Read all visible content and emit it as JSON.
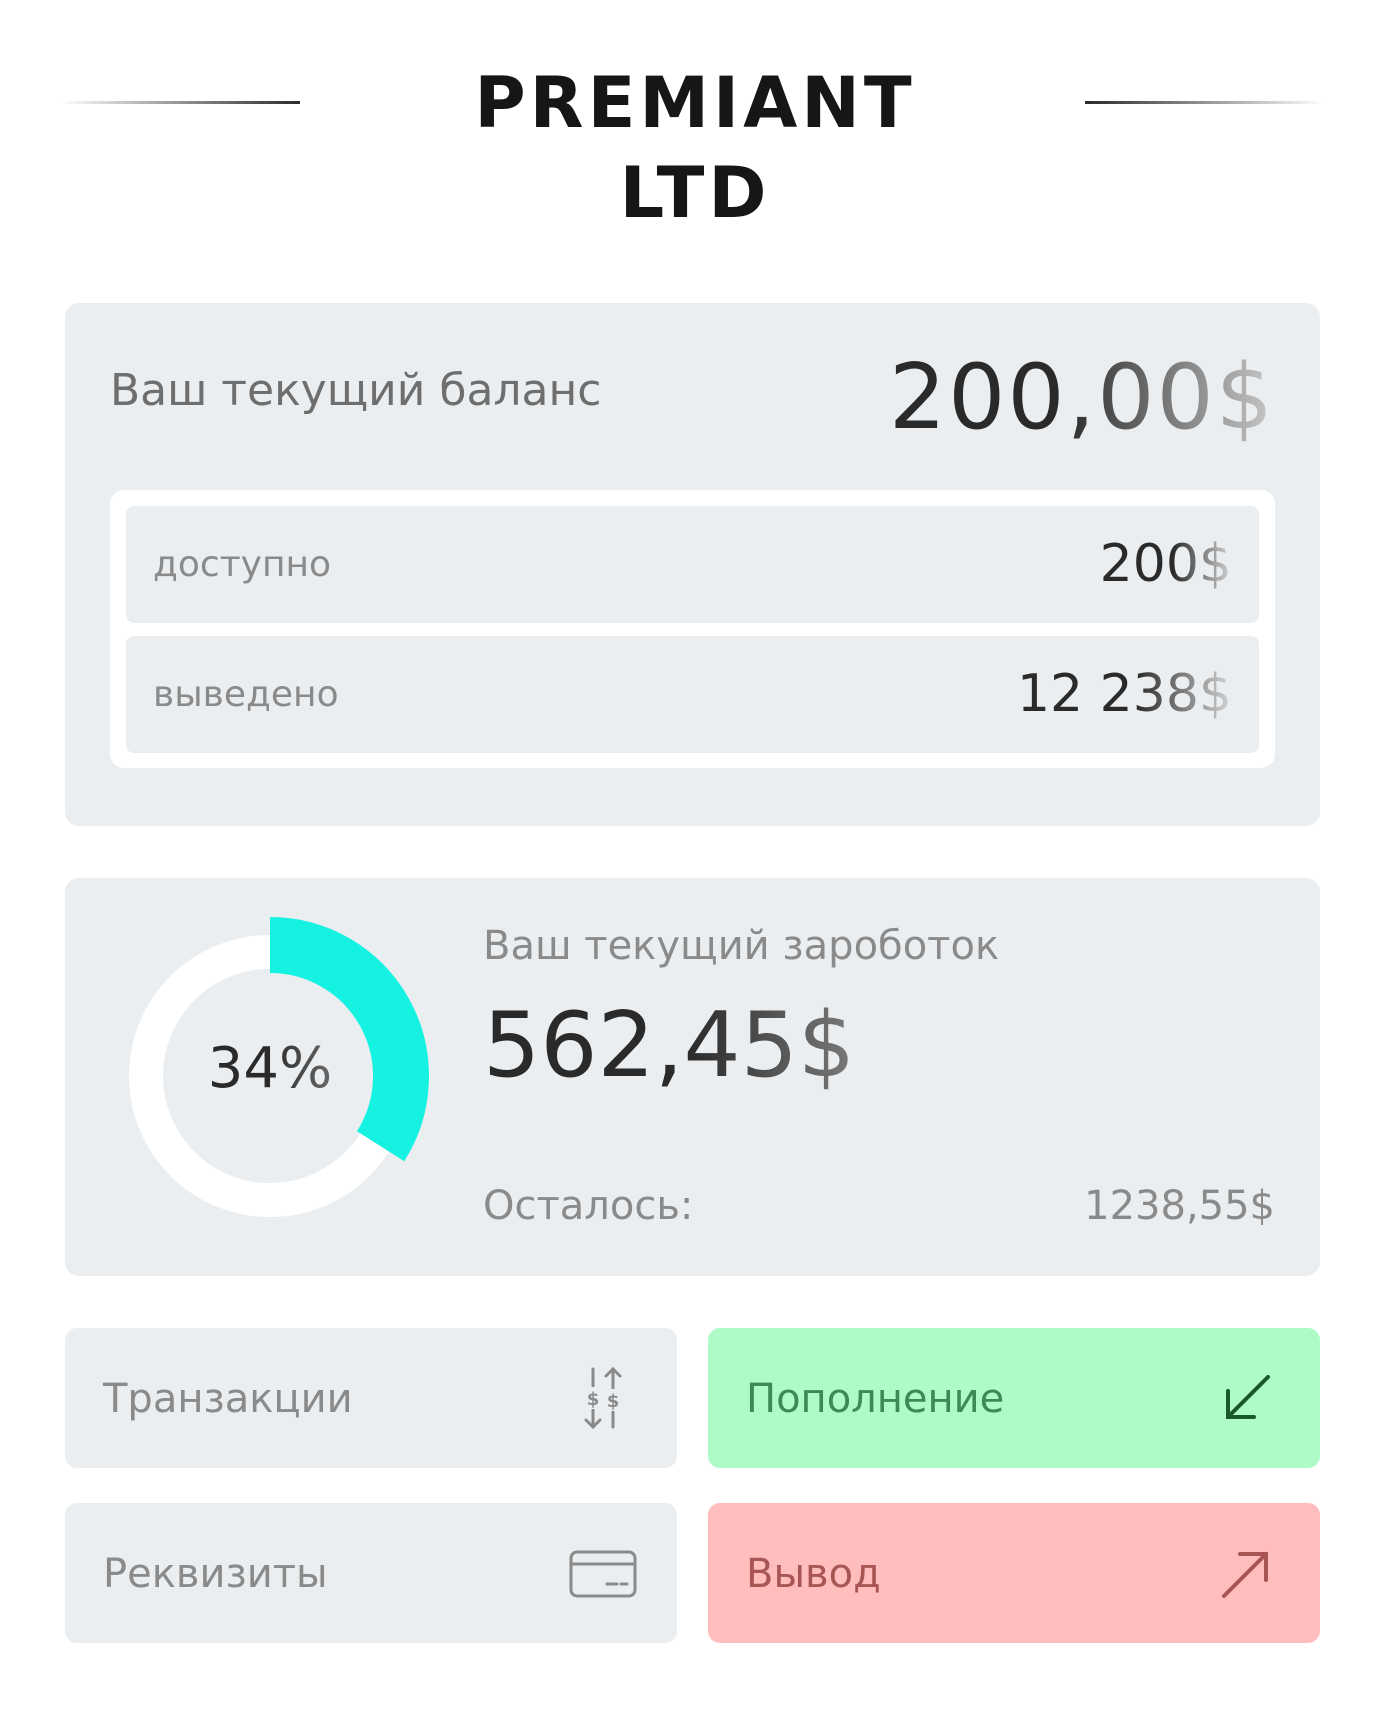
{
  "header": {
    "logo_text": "PREMIANT LTD"
  },
  "balance": {
    "title": "Ваш текущий баланс",
    "amount": "200,00$",
    "available_label": "доступно",
    "available_value": "200$",
    "withdrawn_label": "выведено",
    "withdrawn_value": "12 238$"
  },
  "earnings": {
    "title": "Ваш текущий зароботок",
    "amount": "562,45$",
    "progress_percent": 34,
    "progress_label": "34%",
    "remaining_label": "Осталось:",
    "remaining_value": "1238,55$",
    "accent_color": "#16f2e1"
  },
  "actions": {
    "transactions_label": "Транзакции",
    "deposit_label": "Пополнение",
    "requisites_label": "Реквизиты",
    "withdraw_label": "Вывод"
  },
  "icons": {
    "transactions": "dollar-exchange-icon",
    "deposit": "arrow-down-left-icon",
    "requisites": "card-icon",
    "withdraw": "arrow-up-right-icon"
  },
  "colors": {
    "deposit_bg": "#aefbc8",
    "withdraw_bg": "#ffbdbd",
    "card_bg": "#ebeef0"
  }
}
